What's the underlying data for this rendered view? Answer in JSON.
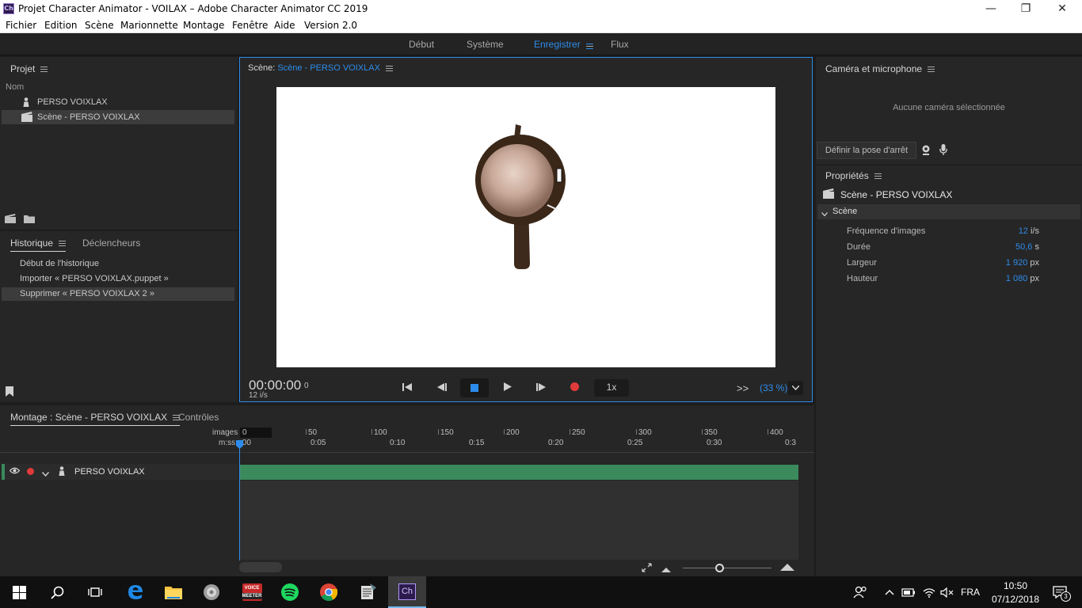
{
  "window": {
    "title": "Projet Character Animator - VOILAX – Adobe Character Animator CC 2019",
    "app_badge": "Ch"
  },
  "menu": [
    "Fichier",
    "Edition",
    "Scène",
    "Marionnette",
    "Montage",
    "Fenêtre",
    "Aide",
    "Version 2.0"
  ],
  "workspaces": [
    "Début",
    "Système",
    "Enregistrer",
    "Flux"
  ],
  "project": {
    "title": "Projet",
    "column": "Nom",
    "items": [
      "PERSO VOIXLAX",
      "Scène - PERSO VOIXLAX"
    ]
  },
  "history": {
    "tab_active": "Historique",
    "tab_other": "Déclencheurs",
    "items": [
      "Début de l'historique",
      "Importer « PERSO VOIXLAX.puppet »",
      "Supprimer « PERSO VOIXLAX 2 »"
    ]
  },
  "scene": {
    "label": "Scène:",
    "name": "Scène - PERSO VOIXLAX",
    "timecode": "00:00:00",
    "frame": "0",
    "fps": "12 i/s",
    "speed": "1x",
    "zoom": "(33 %)",
    "expand": ">>"
  },
  "timeline": {
    "tab_active": "Montage : Scène - PERSO VOIXLAX",
    "tab_other": "Contrôles",
    "images_label": "images",
    "time_label": "m:ss",
    "frame_ticks": [
      "0",
      "50",
      "100",
      "150",
      "200",
      "250",
      "300",
      "350",
      "400"
    ],
    "time_ticks": [
      ":00",
      "0:05",
      "0:10",
      "0:15",
      "0:20",
      "0:25",
      "0:30",
      "0:3"
    ],
    "track_name": "PERSO VOIXLAX"
  },
  "camera": {
    "title": "Caméra et microphone",
    "no_camera": "Aucune caméra sélectionnée",
    "rest_pose_button": "Définir la pose d'arrêt"
  },
  "properties": {
    "title": "Propriétés",
    "scene_name": "Scène - PERSO VOIXLAX",
    "section": "Scène",
    "rows": [
      {
        "label": "Fréquence d'images",
        "value": "12",
        "unit": "i/s"
      },
      {
        "label": "Durée",
        "value": "50,6",
        "unit": "s"
      },
      {
        "label": "Largeur",
        "value": "1 920",
        "unit": "px"
      },
      {
        "label": "Hauteur",
        "value": "1 080",
        "unit": "px"
      }
    ]
  },
  "taskbar": {
    "voicemeeter_top": "VOICE",
    "voicemeeter_bottom": "MEETER",
    "lang": "FRA",
    "time": "10:50",
    "date": "07/12/2018",
    "notifications": "3"
  },
  "colors": {
    "accent": "#2d8ceb",
    "track": "#3a8a5c",
    "record": "#e03a3a"
  }
}
